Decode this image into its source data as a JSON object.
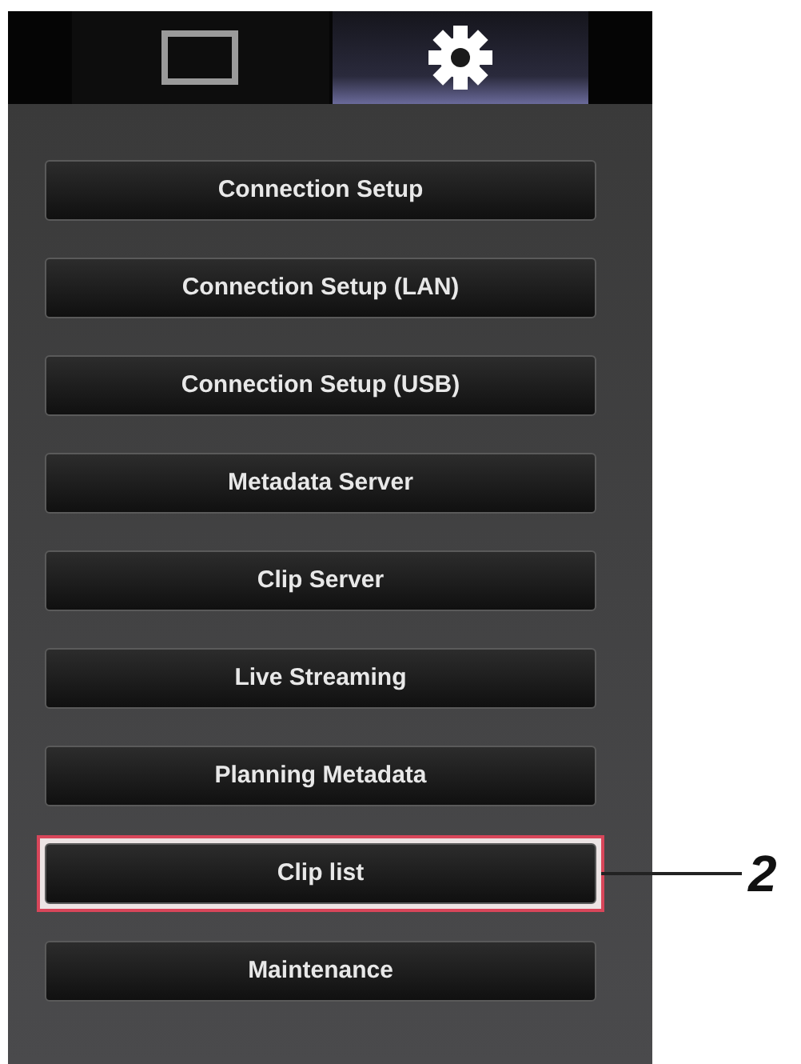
{
  "tabs": [
    {
      "kind": "monitor",
      "selected": false
    },
    {
      "kind": "settings",
      "selected": true
    }
  ],
  "menu_items": [
    {
      "label": "Connection Setup",
      "highlighted": false
    },
    {
      "label": "Connection Setup (LAN)",
      "highlighted": false
    },
    {
      "label": "Connection Setup (USB)",
      "highlighted": false
    },
    {
      "label": "Metadata Server",
      "highlighted": false
    },
    {
      "label": "Clip Server",
      "highlighted": false
    },
    {
      "label": "Live Streaming",
      "highlighted": false
    },
    {
      "label": "Planning Metadata",
      "highlighted": false
    },
    {
      "label": "Clip list",
      "highlighted": true
    },
    {
      "label": "Maintenance",
      "highlighted": false
    }
  ],
  "callout": {
    "label": "2"
  }
}
